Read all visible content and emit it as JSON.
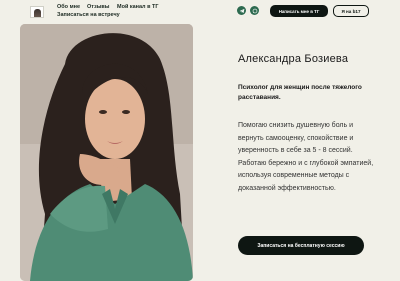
{
  "header": {
    "nav": [
      "Обо мне",
      "Отзывы",
      "Мой канал в ТГ",
      "Записаться на встречу"
    ],
    "icons": [
      "telegram-icon",
      "whatsapp-icon"
    ],
    "write_tg_label": "Написать мне в ТГ",
    "faq_label": "Я на b17"
  },
  "hero": {
    "name": "Александра Бозиева",
    "lead": "Психолог для женщин после тяжелого расставания.",
    "description": "Помогаю снизить душевную боль и вернуть самооценку, спокойствие и уверенность в себе за 5 - 8 сессий. Работаю бережно и с глубокой эмпатией, используя современные методы с доказанной эффективностью.",
    "cta_label": "Записаться на бесплатную сессию"
  },
  "colors": {
    "background": "#f1f0e8",
    "accent_green": "#2d6a4f",
    "button_dark": "#0e1612"
  }
}
